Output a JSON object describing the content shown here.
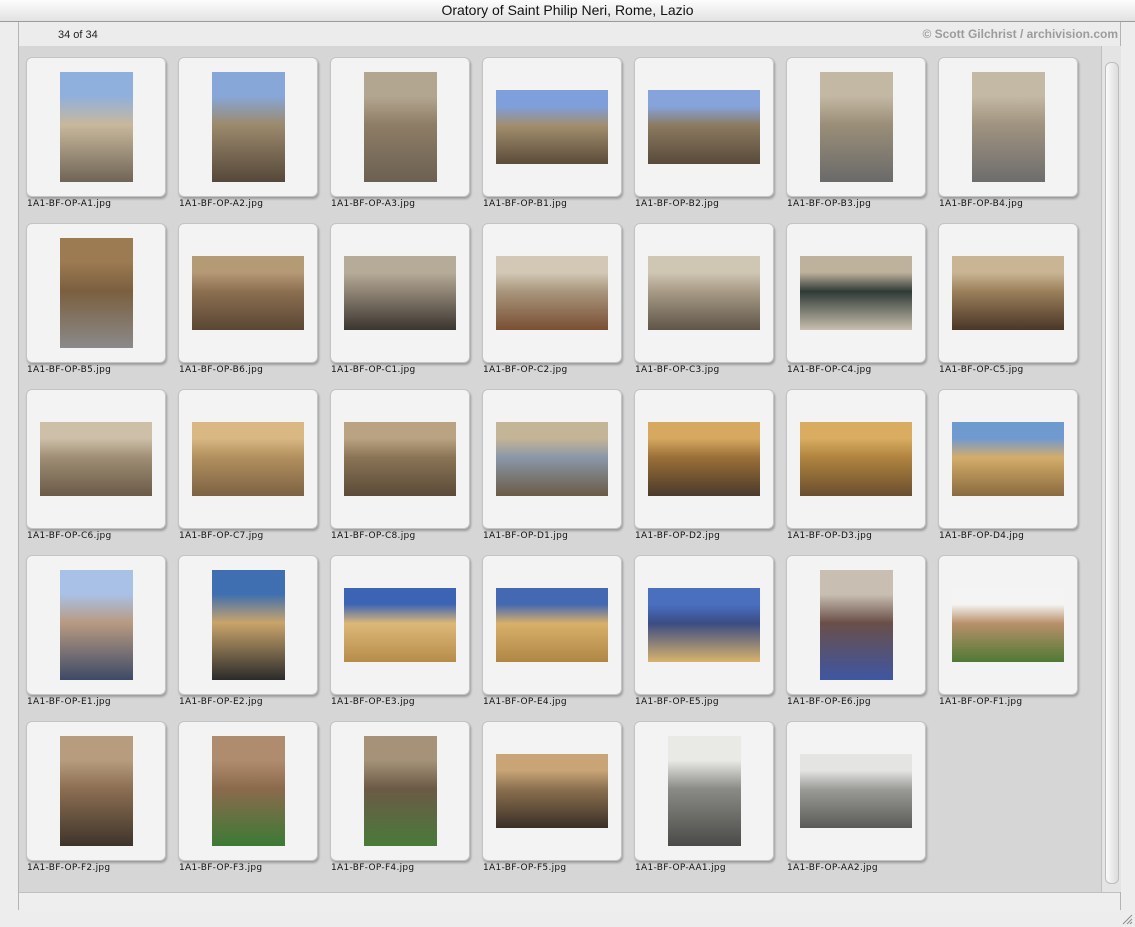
{
  "window": {
    "title": "Oratory of Saint Philip Neri, Rome, Lazio",
    "count_label": "34 of 34",
    "credit": "© Scott Gilchrist / archivision.com"
  },
  "thumbnails": [
    {
      "filename": "1A1-BF-OP-A1.jpg",
      "orientation": "portrait",
      "colors": [
        "#8fb0dd",
        "#c8b89c",
        "#6f6456"
      ]
    },
    {
      "filename": "1A1-BF-OP-A2.jpg",
      "orientation": "portrait",
      "colors": [
        "#86a7d8",
        "#9c8a6c",
        "#55473a"
      ]
    },
    {
      "filename": "1A1-BF-OP-A3.jpg",
      "orientation": "portrait",
      "colors": [
        "#b3a690",
        "#8e7d66",
        "#6b6052"
      ]
    },
    {
      "filename": "1A1-BF-OP-B1.jpg",
      "orientation": "landscape",
      "colors": [
        "#7f9fdc",
        "#a28e6e",
        "#5b4b3a"
      ]
    },
    {
      "filename": "1A1-BF-OP-B2.jpg",
      "orientation": "landscape",
      "colors": [
        "#86a3dc",
        "#8c7a60",
        "#584a3b"
      ]
    },
    {
      "filename": "1A1-BF-OP-B3.jpg",
      "orientation": "portrait",
      "colors": [
        "#c3b8a3",
        "#9a8e78",
        "#6a6a6a"
      ]
    },
    {
      "filename": "1A1-BF-OP-B4.jpg",
      "orientation": "portrait",
      "colors": [
        "#c4b9a5",
        "#a09380",
        "#6d6d6d"
      ]
    },
    {
      "filename": "1A1-BF-OP-B5.jpg",
      "orientation": "portrait",
      "colors": [
        "#9c7a52",
        "#7b5f3f",
        "#8a8a8a"
      ]
    },
    {
      "filename": "1A1-BF-OP-B6.jpg",
      "orientation": "landscape",
      "colors": [
        "#b59a76",
        "#8b6f50",
        "#5a4634"
      ]
    },
    {
      "filename": "1A1-BF-OP-C1.jpg",
      "orientation": "landscape",
      "colors": [
        "#b6aa98",
        "#8f8475",
        "#3b352f"
      ]
    },
    {
      "filename": "1A1-BF-OP-C2.jpg",
      "orientation": "landscape",
      "colors": [
        "#d3c8b6",
        "#a8967c",
        "#7a4e32"
      ]
    },
    {
      "filename": "1A1-BF-OP-C3.jpg",
      "orientation": "landscape",
      "colors": [
        "#d0c6b4",
        "#a79a86",
        "#5f5548"
      ]
    },
    {
      "filename": "1A1-BF-OP-C4.jpg",
      "orientation": "landscape",
      "colors": [
        "#bfb29c",
        "#2f3a36",
        "#c8bfae"
      ]
    },
    {
      "filename": "1A1-BF-OP-C5.jpg",
      "orientation": "landscape",
      "colors": [
        "#c9b594",
        "#9b7f5a",
        "#4a3628"
      ]
    },
    {
      "filename": "1A1-BF-OP-C6.jpg",
      "orientation": "landscape",
      "colors": [
        "#cdbfa8",
        "#9f8e74",
        "#6a5a48"
      ]
    },
    {
      "filename": "1A1-BF-OP-C7.jpg",
      "orientation": "landscape",
      "colors": [
        "#d9b884",
        "#b28f5e",
        "#7c6244"
      ]
    },
    {
      "filename": "1A1-BF-OP-C8.jpg",
      "orientation": "landscape",
      "colors": [
        "#b9a382",
        "#8a7456",
        "#5b4a38"
      ]
    },
    {
      "filename": "1A1-BF-OP-D1.jpg",
      "orientation": "landscape",
      "colors": [
        "#c4b596",
        "#8a97a8",
        "#6b5b45"
      ]
    },
    {
      "filename": "1A1-BF-OP-D2.jpg",
      "orientation": "landscape",
      "colors": [
        "#d6a860",
        "#9a6f38",
        "#4a3a2a"
      ]
    },
    {
      "filename": "1A1-BF-OP-D3.jpg",
      "orientation": "landscape",
      "colors": [
        "#d9ac62",
        "#b0843f",
        "#6a4e2e"
      ]
    },
    {
      "filename": "1A1-BF-OP-D4.jpg",
      "orientation": "landscape",
      "colors": [
        "#6f9ad0",
        "#d4ad6a",
        "#8a6a3e"
      ]
    },
    {
      "filename": "1A1-BF-OP-E1.jpg",
      "orientation": "portrait",
      "colors": [
        "#a9c1e6",
        "#b89a82",
        "#3d4a66"
      ]
    },
    {
      "filename": "1A1-BF-OP-E2.jpg",
      "orientation": "portrait",
      "colors": [
        "#3f6fb0",
        "#c9a46a",
        "#2b2b2b"
      ]
    },
    {
      "filename": "1A1-BF-OP-E3.jpg",
      "orientation": "landscape",
      "colors": [
        "#3d64b4",
        "#dcb878",
        "#b78c4a"
      ]
    },
    {
      "filename": "1A1-BF-OP-E4.jpg",
      "orientation": "landscape",
      "colors": [
        "#4468b2",
        "#d8b06a",
        "#b08646"
      ]
    },
    {
      "filename": "1A1-BF-OP-E5.jpg",
      "orientation": "landscape",
      "colors": [
        "#4a6fbf",
        "#3b4c84",
        "#d9b36c"
      ]
    },
    {
      "filename": "1A1-BF-OP-E6.jpg",
      "orientation": "portrait",
      "colors": [
        "#c8bfb2",
        "#6a4f48",
        "#3f56a2"
      ]
    },
    {
      "filename": "1A1-BF-OP-F1.jpg",
      "orientation": "landscape",
      "colors": [
        "#f4f4f4",
        "#b89069",
        "#4f7a36"
      ]
    },
    {
      "filename": "1A1-BF-OP-F2.jpg",
      "orientation": "portrait",
      "colors": [
        "#b79c7e",
        "#8c6e52",
        "#3e342a"
      ]
    },
    {
      "filename": "1A1-BF-OP-F3.jpg",
      "orientation": "portrait",
      "colors": [
        "#b08c6e",
        "#8b6a4c",
        "#3c7a36"
      ]
    },
    {
      "filename": "1A1-BF-OP-F4.jpg",
      "orientation": "portrait",
      "colors": [
        "#a59278",
        "#6b5a46",
        "#4a7a3a"
      ]
    },
    {
      "filename": "1A1-BF-OP-F5.jpg",
      "orientation": "landscape",
      "colors": [
        "#c9a477",
        "#8a6f4f",
        "#3b2f26"
      ]
    },
    {
      "filename": "1A1-BF-OP-AA1.jpg",
      "orientation": "portrait",
      "colors": [
        "#e9e9e6",
        "#8a8a86",
        "#4a4a48"
      ]
    },
    {
      "filename": "1A1-BF-OP-AA2.jpg",
      "orientation": "landscape",
      "colors": [
        "#e4e4e2",
        "#9a9a96",
        "#5a5a58"
      ]
    }
  ]
}
